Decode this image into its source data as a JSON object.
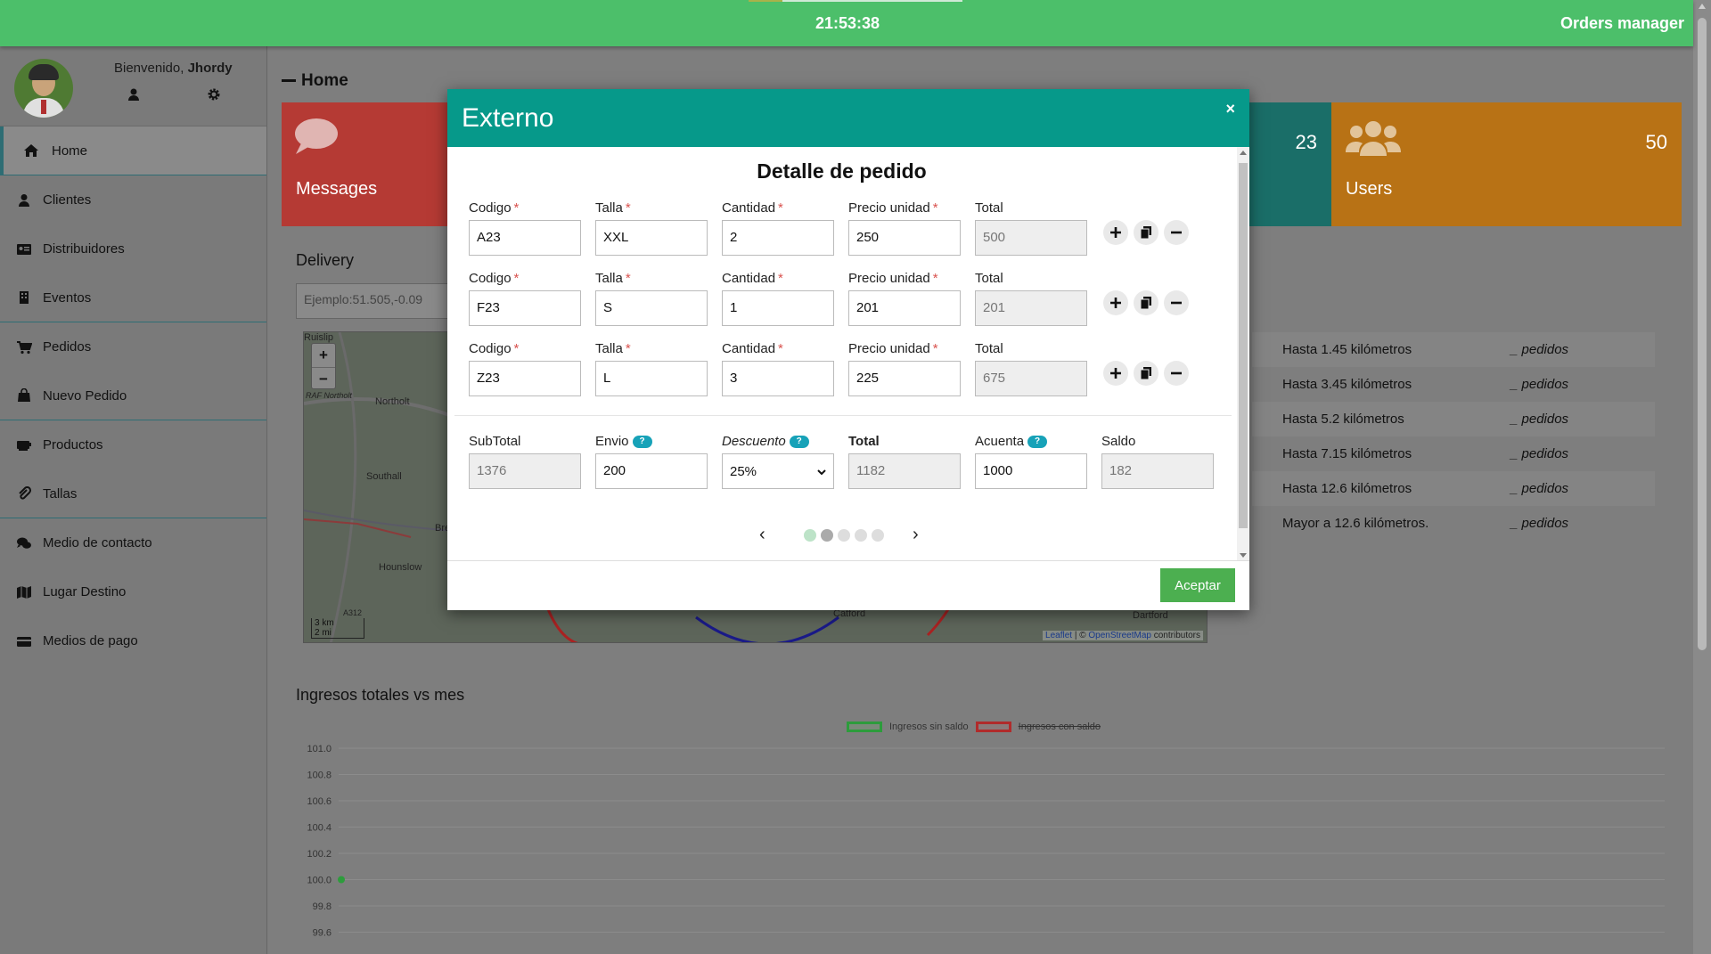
{
  "topbar": {
    "clock": "21:53:38",
    "brand": "Orders manager",
    "progress": 0.16,
    "color": "#4cbf6a"
  },
  "profile": {
    "greeting": "Bienvenido,",
    "username": "Jhordy"
  },
  "sidebar": {
    "items": [
      {
        "label": "Home",
        "icon": "home-icon"
      },
      {
        "label": "Clientes",
        "icon": "user-icon"
      },
      {
        "label": "Distribuidores",
        "icon": "id-card-icon"
      },
      {
        "label": "Eventos",
        "icon": "building-icon"
      },
      {
        "label": "Pedidos",
        "icon": "cart-icon"
      },
      {
        "label": "Nuevo Pedido",
        "icon": "bag-icon"
      },
      {
        "label": "Productos",
        "icon": "box-icon"
      },
      {
        "label": "Tallas",
        "icon": "paperclip-icon"
      },
      {
        "label": "Medio de contacto",
        "icon": "chat-icon"
      },
      {
        "label": "Lugar Destino",
        "icon": "map-icon"
      },
      {
        "label": "Medios de pago",
        "icon": "credit-card-icon"
      }
    ]
  },
  "main": {
    "title": "Home",
    "cards": [
      {
        "label": "Messages",
        "count": "",
        "color": "#b53a34"
      },
      {
        "label": "",
        "count": "23",
        "color": "#1a6e68"
      },
      {
        "label": "Users",
        "count": "50",
        "color": "#b87215"
      }
    ],
    "delivery": {
      "title": "Delivery",
      "placeholder": "Ejemplo:51.505,-0.09"
    },
    "map": {
      "zoom_in": "+",
      "zoom_out": "−",
      "places": [
        "Ruislip",
        "RAF Northolt",
        "Northolt",
        "Southall",
        "Hounslow",
        "Bre",
        "Catford",
        "Dartford",
        "A312"
      ],
      "scale_km": "3 km",
      "scale_mi": "2 mi",
      "attribution_link1": "Leaflet",
      "attribution_sep": " | © ",
      "attribution_link2": "OpenStreetMap",
      "attribution_tail": " contributors"
    },
    "ranges": [
      {
        "text": "Hasta 1.45 kilómetros",
        "orders": "_ pedidos"
      },
      {
        "text": "Hasta 3.45 kilómetros",
        "orders": "_ pedidos"
      },
      {
        "text": "Hasta 5.2 kilómetros",
        "orders": "_ pedidos"
      },
      {
        "text": "Hasta 7.15 kilómetros",
        "orders": "_ pedidos"
      },
      {
        "text": "Hasta 12.6 kilómetros",
        "orders": "_ pedidos"
      },
      {
        "text": "Mayor a 12.6 kilómetros.",
        "orders": "_ pedidos"
      }
    ],
    "income_title": "Ingresos totales vs  mes"
  },
  "chart_data": {
    "type": "line",
    "title": "",
    "series": [
      {
        "name": "Ingresos sin saldo",
        "color": "#2d9c3c",
        "hidden": false,
        "values": [
          100.0
        ]
      },
      {
        "name": "Ingresos con saldo",
        "color": "#b02b2b",
        "hidden": true,
        "values": []
      }
    ],
    "yticks": [
      "101.0",
      "100.8",
      "100.6",
      "100.4",
      "100.2",
      "100.0",
      "99.8",
      "99.6",
      "99.4"
    ],
    "ylim": [
      99.4,
      101.0
    ],
    "grid": true,
    "legend": "top-center"
  },
  "modal": {
    "title": "Externo",
    "close": "×",
    "section_title": "Detalle de pedido",
    "labels": {
      "codigo": "Codigo",
      "talla": "Talla",
      "cantidad": "Cantidad",
      "precio": "Precio unidad",
      "total": "Total",
      "required_mark": "*"
    },
    "rows": [
      {
        "codigo": "A23",
        "talla": "XXL",
        "cantidad": "2",
        "precio": "250",
        "total": "500"
      },
      {
        "codigo": "F23",
        "talla": "S",
        "cantidad": "1",
        "precio": "201",
        "total": "201"
      },
      {
        "codigo": "Z23",
        "talla": "L",
        "cantidad": "3",
        "precio": "225",
        "total": "675"
      }
    ],
    "summary": {
      "subtotal_label": "SubTotal",
      "subtotal": "1376",
      "envio_label": "Envio",
      "envio": "200",
      "descuento_label": "Descuento",
      "descuento": "25%",
      "total_label": "Total",
      "total": "1182",
      "acuenta_label": "Acuenta",
      "acuenta": "1000",
      "saldo_label": "Saldo",
      "saldo": "182",
      "help": "?"
    },
    "pager": {
      "prev": "‹",
      "next": "›",
      "pages": 5,
      "current": 2
    },
    "accept": "Aceptar",
    "header_color": "#06998a"
  }
}
